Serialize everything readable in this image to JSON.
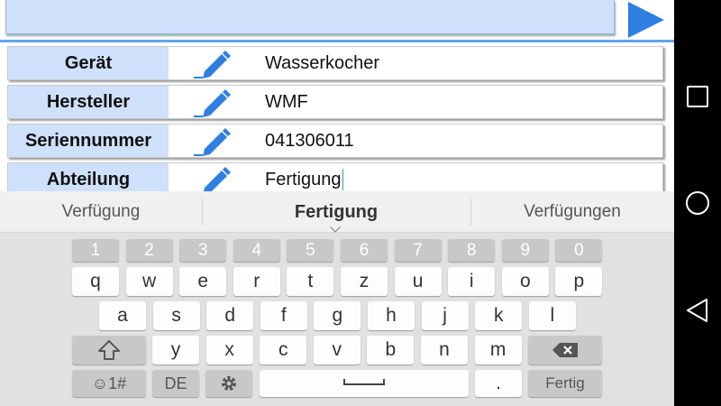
{
  "form": {
    "rows": [
      {
        "label": "Gerät",
        "value": "Wasserkocher"
      },
      {
        "label": "Hersteller",
        "value": "WMF"
      },
      {
        "label": "Seriennummer",
        "value": "041306011"
      },
      {
        "label": "Abteilung",
        "value": "Fertigung"
      }
    ]
  },
  "keyboard": {
    "suggestions": [
      "Verfügung",
      "Fertigung",
      "Verfügungen"
    ],
    "number_row": [
      "1",
      "2",
      "3",
      "4",
      "5",
      "6",
      "7",
      "8",
      "9",
      "0"
    ],
    "row1": [
      "q",
      "w",
      "e",
      "r",
      "t",
      "z",
      "u",
      "i",
      "o",
      "p"
    ],
    "row1_hints": [
      "+",
      "×",
      "÷",
      "=",
      "%",
      "/",
      "\\",
      "~",
      "[",
      "]"
    ],
    "row2": [
      "a",
      "s",
      "d",
      "f",
      "g",
      "h",
      "j",
      "k",
      "l"
    ],
    "row2_hints": [
      "@",
      "",
      "",
      "#",
      "",
      ":",
      "&",
      "(",
      ")"
    ],
    "row3": [
      "y",
      "x",
      "c",
      "v",
      "b",
      "n",
      "m"
    ],
    "row3_hints": [
      "",
      "",
      "",
      "",
      "",
      "",
      ""
    ],
    "symbols_key": "☺1#",
    "language_key": "DE",
    "period_key": ".",
    "enter_key": "Fertig"
  },
  "colors": {
    "label_background": "#cfe0fb",
    "accent_blue": "#2f7fe0",
    "divider_blue": "#5fa6ea"
  },
  "icons": {
    "row_edit": "pencil-icon",
    "play": "play-icon",
    "shift": "shift-icon",
    "backspace": "backspace-icon",
    "settings": "gear-icon",
    "nav_recents": "square-icon",
    "nav_home": "circle-icon",
    "nav_back": "triangle-back-icon"
  }
}
